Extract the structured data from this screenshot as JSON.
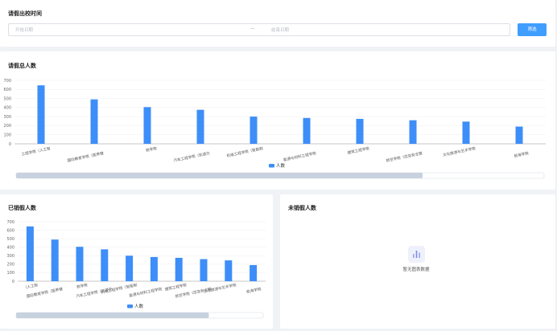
{
  "date_filter": {
    "title": "请假出校时间",
    "start_placeholder": "开始日期",
    "separator": "—",
    "end_placeholder": "结束日期",
    "filter_button": "筛选"
  },
  "total_leave": {
    "title": "请假总人数",
    "chart_data": {
      "type": "bar",
      "categories": [
        "工程学院（人工智",
        "国际教育学院（医养健",
        "商学院",
        "汽车工程学院（轨道交",
        "机电工程学院（智能制",
        "能源与材料工程学院",
        "建筑工程学院",
        "航空学院（应急安全管",
        "文化旅游与艺术学院",
        "航海学院"
      ],
      "series": [
        {
          "name": "人数",
          "values": [
            645,
            490,
            405,
            375,
            300,
            285,
            275,
            260,
            245,
            190
          ]
        }
      ],
      "ylim": [
        0,
        700
      ],
      "yticks": [
        0,
        100,
        200,
        300,
        400,
        500,
        600,
        700
      ],
      "legend": "bottom-center",
      "color": "#3d8ef8"
    },
    "scrollbar": {
      "position": 0,
      "visible_fraction": 0.77
    }
  },
  "cancelled_leave": {
    "title": "已销假人数",
    "chart_data": {
      "type": "bar",
      "categories": [
        "（人工智",
        "国际教育学院（医养健",
        "商学院",
        "汽车工程学院（轨道交",
        "机电工程学院（智能制",
        "能源与材料工程学院",
        "建筑工程学院",
        "航空学院（应急安全管",
        "文化旅游与艺术学院",
        "航海学院"
      ],
      "series": [
        {
          "name": "人数",
          "values": [
            645,
            490,
            405,
            375,
            300,
            285,
            275,
            260,
            245,
            190
          ]
        }
      ],
      "ylim": [
        0,
        700
      ],
      "yticks": [
        0,
        100,
        200,
        300,
        400,
        500,
        600,
        700
      ],
      "legend": "bottom-center",
      "color": "#3d8ef8"
    },
    "scrollbar": {
      "position": 0,
      "visible_fraction": 0.78
    }
  },
  "uncancelled_leave": {
    "title": "未销假人数",
    "empty_text": "暂无图表数据",
    "empty_icon": "bar-chart-icon"
  }
}
